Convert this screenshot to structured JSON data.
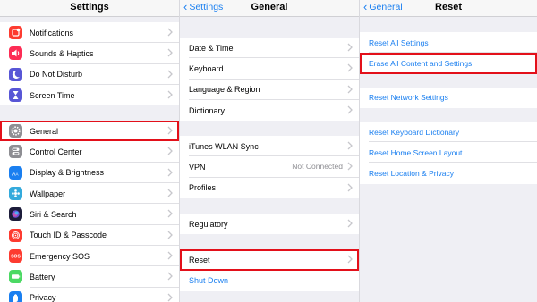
{
  "settings": {
    "title": "Settings",
    "items_a": [
      {
        "label": "Notifications",
        "icon": "notifications-icon",
        "color": "#fd3b30"
      },
      {
        "label": "Sounds & Haptics",
        "icon": "sounds-icon",
        "color": "#fd2d55"
      },
      {
        "label": "Do Not Disturb",
        "icon": "moon-icon",
        "color": "#5856d6"
      },
      {
        "label": "Screen Time",
        "icon": "hourglass-icon",
        "color": "#5856d6"
      }
    ],
    "items_b": [
      {
        "label": "General",
        "icon": "gear-icon",
        "color": "#8e8e93"
      },
      {
        "label": "Control Center",
        "icon": "control-center-icon",
        "color": "#8e8e93"
      },
      {
        "label": "Display & Brightness",
        "icon": "display-icon",
        "color": "#1a7ff0"
      },
      {
        "label": "Wallpaper",
        "icon": "wallpaper-icon",
        "color": "#34aadc"
      },
      {
        "label": "Siri & Search",
        "icon": "siri-icon",
        "color": "#1c1c3a"
      },
      {
        "label": "Touch ID & Passcode",
        "icon": "fingerprint-icon",
        "color": "#fd3b30"
      },
      {
        "label": "Emergency SOS",
        "icon": "sos-icon",
        "color": "#fd3b30"
      },
      {
        "label": "Battery",
        "icon": "battery-icon",
        "color": "#4cd964"
      },
      {
        "label": "Privacy",
        "icon": "hand-icon",
        "color": "#1a7ff0"
      }
    ]
  },
  "general": {
    "back": "Settings",
    "title": "General",
    "group1": [
      "Date & Time",
      "Keyboard",
      "Language & Region",
      "Dictionary"
    ],
    "group2": [
      {
        "label": "iTunes WLAN Sync",
        "value": ""
      },
      {
        "label": "VPN",
        "value": "Not Connected"
      },
      {
        "label": "Profiles",
        "value": ""
      }
    ],
    "group3": [
      "Regulatory"
    ],
    "reset": "Reset",
    "shutdown": "Shut Down"
  },
  "reset": {
    "back": "General",
    "title": "Reset",
    "group1": [
      "Reset All Settings",
      "Erase All Content and Settings"
    ],
    "group2": [
      "Reset Network Settings"
    ],
    "group3": [
      "Reset Keyboard Dictionary",
      "Reset Home Screen Layout",
      "Reset Location & Privacy"
    ]
  },
  "colors": {
    "accent": "#1a7ff0",
    "highlight": "#e3101a"
  }
}
